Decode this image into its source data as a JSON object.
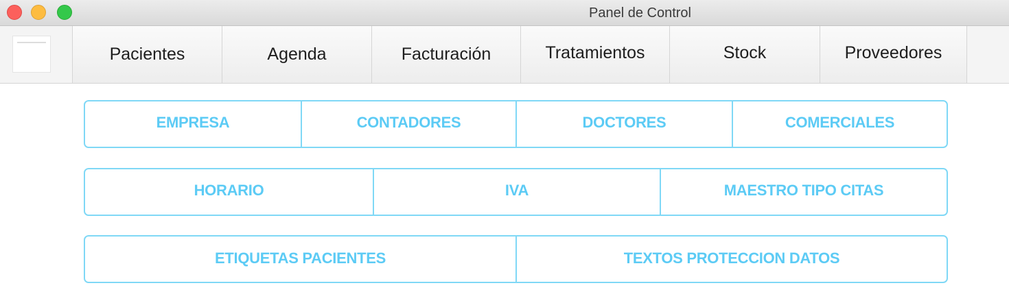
{
  "window": {
    "title": "Panel de Control"
  },
  "tabs": [
    {
      "label": "Pacientes"
    },
    {
      "label": "Agenda"
    },
    {
      "label": "Facturación"
    },
    {
      "label": "Tratamientos"
    },
    {
      "label": "Stock"
    },
    {
      "label": "Proveedores"
    }
  ],
  "config_rows": [
    {
      "buttons": [
        "EMPRESA",
        "CONTADORES",
        "DOCTORES",
        "COMERCIALES"
      ]
    },
    {
      "buttons": [
        "HORARIO",
        "IVA",
        "MAESTRO TIPO CITAS"
      ]
    },
    {
      "buttons": [
        "ETIQUETAS PACIENTES",
        "TEXTOS PROTECCION DATOS"
      ]
    }
  ],
  "colors": {
    "accent": "#5ccbf5",
    "accent_border": "#7fd8f6",
    "close": "#fc605c",
    "minimize": "#fdbc40",
    "maximize": "#34c84a"
  },
  "icons": {
    "app_logo": "app-logo-icon"
  }
}
